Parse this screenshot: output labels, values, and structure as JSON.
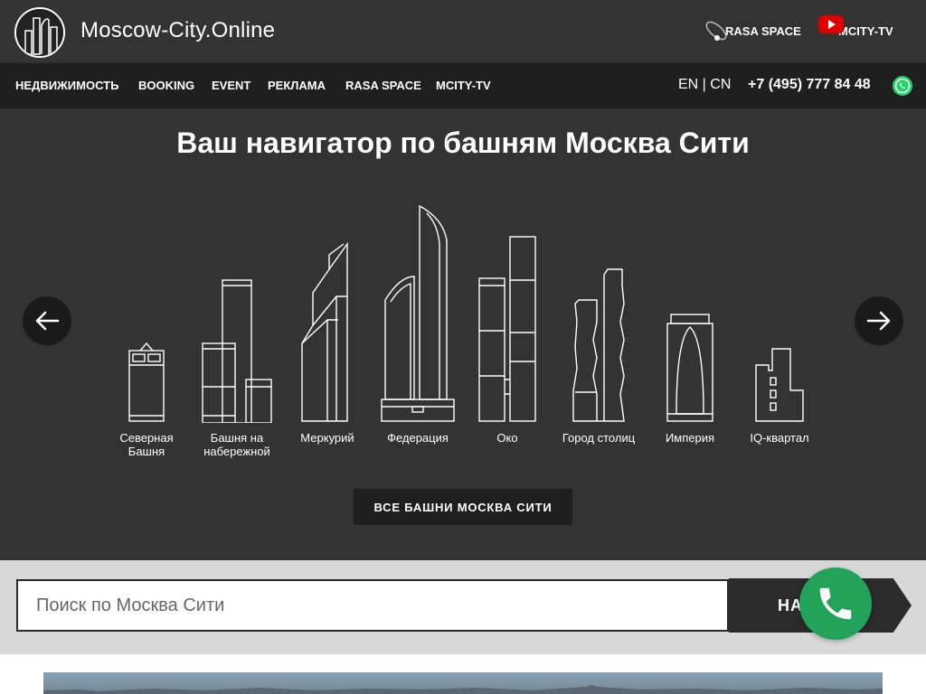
{
  "header": {
    "site_title": "Moscow-City.Online",
    "brands": [
      {
        "label": "RASA SPACE",
        "icon": "rasa-space-logo"
      },
      {
        "label": "MCITY-TV",
        "icon": "youtube-icon",
        "icon_color": "#e00000"
      }
    ]
  },
  "nav": {
    "items": [
      "НЕДВИЖИМОСТЬ",
      "BOOKING",
      "EVENT",
      "РЕКЛАМА",
      "RASA SPACE",
      "MCITY-TV"
    ],
    "lang": "EN | CN",
    "phone": "+7 (495) 777 84 48",
    "whatsapp_icon": "whatsapp-icon",
    "whatsapp_color": "#25d366"
  },
  "hero": {
    "title": "Ваш навигатор по башням Москва Сити",
    "towers": [
      {
        "label": "Северная Башня"
      },
      {
        "label": "Башня на набережной"
      },
      {
        "label": "Меркурий"
      },
      {
        "label": "Федерация"
      },
      {
        "label": "Око"
      },
      {
        "label": "Город столиц"
      },
      {
        "label": "Империя"
      },
      {
        "label": "IQ-квартал"
      }
    ],
    "all_button": "ВСЕ БАШНИ МОСКВА СИТИ"
  },
  "search": {
    "placeholder": "Поиск по Москва Сити",
    "button_label": "НАЙТИ"
  },
  "call_button": {
    "icon": "phone-icon",
    "color": "#23a35a"
  },
  "colors": {
    "header_bg": "#333333",
    "nav_bg": "#1f1f1f",
    "hero_bg": "#333333",
    "search_area_bg": "#d8d8d8"
  }
}
